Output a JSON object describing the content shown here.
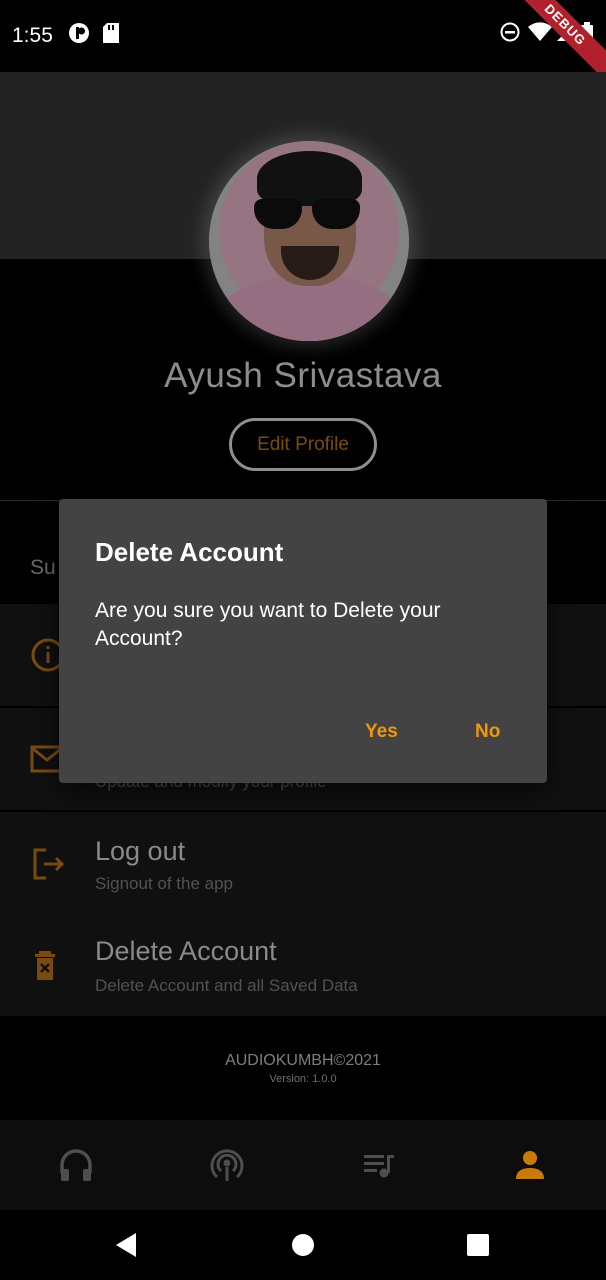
{
  "status_bar": {
    "time": "1:55",
    "icons": [
      "notification-icon",
      "sd-card-icon",
      "do-not-disturb-icon",
      "wifi-icon",
      "signal-icon",
      "battery-icon"
    ],
    "debug_label": "DEBUG"
  },
  "profile": {
    "name": "Ayush Srivastava",
    "edit_label": "Edit Profile"
  },
  "section": {
    "heading_partial": "Su"
  },
  "menu": [
    {
      "icon": "info-icon",
      "title": "",
      "subtitle": ""
    },
    {
      "icon": "mail-icon",
      "title": "",
      "subtitle": "Update and modify your profile"
    },
    {
      "icon": "logout-icon",
      "title": "Log out",
      "subtitle": "Signout of the app"
    },
    {
      "icon": "trash-icon",
      "title": "Delete Account",
      "subtitle": "Delete Account and all Saved Data"
    }
  ],
  "footer": {
    "brand": "AUDIOKUMBH©2021",
    "version": "Version: 1.0.0"
  },
  "bottom_nav": [
    {
      "icon": "headphones-icon",
      "active": false
    },
    {
      "icon": "podcast-icon",
      "active": false
    },
    {
      "icon": "playlist-icon",
      "active": false
    },
    {
      "icon": "person-icon",
      "active": true
    }
  ],
  "dialog": {
    "title": "Delete Account",
    "message": "Are you sure you want to Delete your Account?",
    "yes_label": "Yes",
    "no_label": "No"
  },
  "colors": {
    "accent": "#f0960f",
    "dim_accent": "#7a4b10",
    "dialog_bg": "#434343",
    "debug_banner": "#b0212b"
  }
}
